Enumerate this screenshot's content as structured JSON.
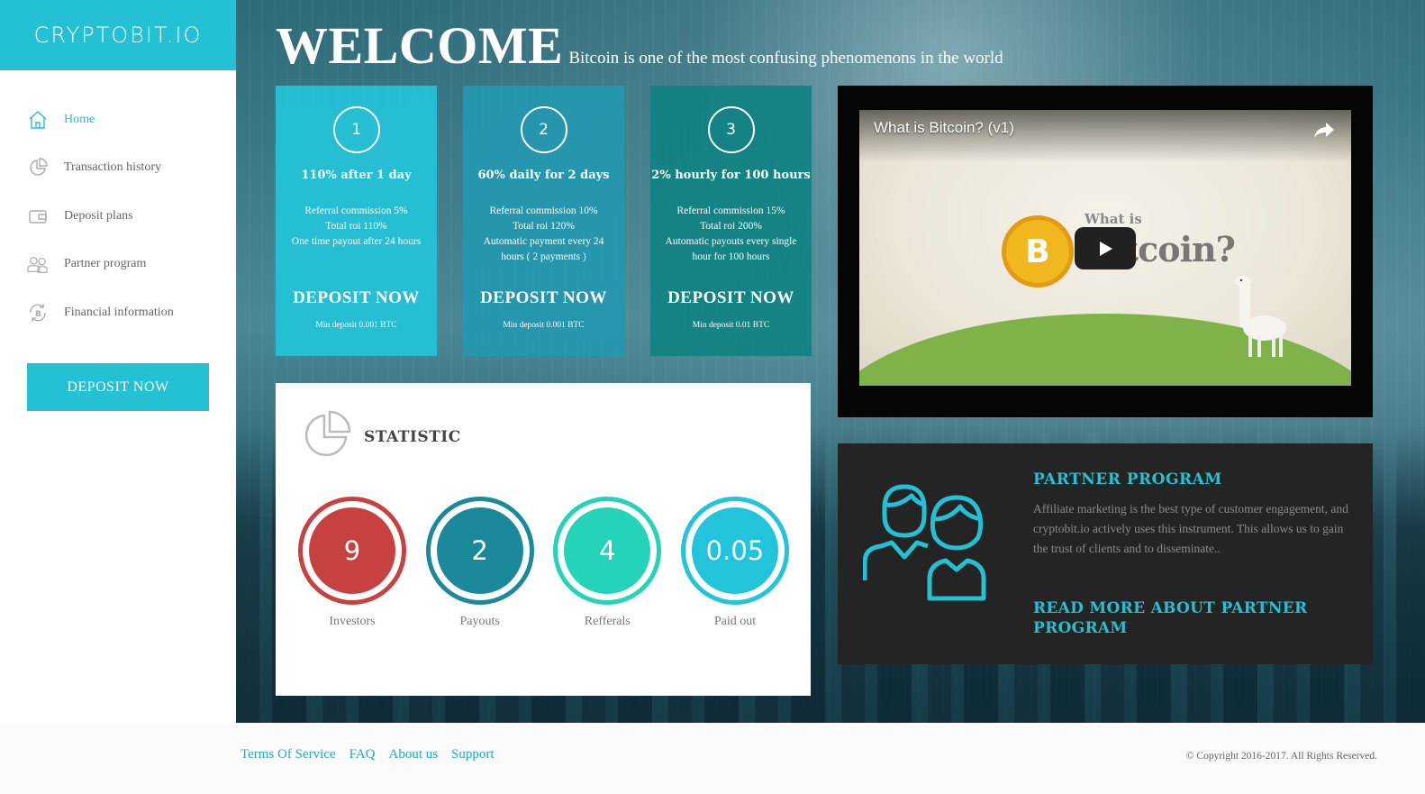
{
  "brand": {
    "logo": "CRYPTOBIT.IO"
  },
  "sidebar": {
    "items": [
      {
        "label": "Home",
        "icon": "home-icon",
        "active": true
      },
      {
        "label": "Transaction history",
        "icon": "pie-chart-icon"
      },
      {
        "label": "Deposit plans",
        "icon": "wallet-icon"
      },
      {
        "label": "Partner program",
        "icon": "users-icon"
      },
      {
        "label": "Financial information",
        "icon": "bitcoin-cycle-icon"
      }
    ],
    "cta": "DEPOSIT NOW"
  },
  "hero": {
    "title": "WELCOME",
    "subtitle": "Bitcoin is one of the most confusing phenomenons in the world"
  },
  "plans": [
    {
      "number": "1",
      "title": "110% after 1 day",
      "lines": [
        "Referral commission  5%",
        "Total roi 110%",
        "One time payout after 24 hours"
      ],
      "cta": "DEPOSIT NOW",
      "min": "Min deposit 0.001 BTC"
    },
    {
      "number": "2",
      "title": "60% daily for 2 days",
      "lines": [
        "Referral commission 10%",
        "Total roi 120%",
        "Automatic payment every 24",
        "hours ( 2 payments )"
      ],
      "cta": "DEPOSIT NOW",
      "min": "Min deposit 0.001 BTC"
    },
    {
      "number": "3",
      "title": "2% hourly for 100 hours",
      "lines": [
        "Referral commission 15%",
        "Total roi 200%",
        "Automatic payouts every single",
        "hour for 100 hours"
      ],
      "cta": "DEPOSIT NOW",
      "min": "Min deposit 0.01 BTC"
    }
  ],
  "statistic": {
    "title": "STATISTIC",
    "items": [
      {
        "value": "9",
        "label": "Investors",
        "color": "#c64140"
      },
      {
        "value": "2",
        "label": "Payouts",
        "color": "#1a8a9a"
      },
      {
        "value": "4",
        "label": "Refferals",
        "color": "#25d4b8"
      },
      {
        "value": "0.05",
        "label": "Paid out",
        "color": "#22c4dc"
      }
    ]
  },
  "video": {
    "title": "What is Bitcoin? (v1)",
    "overlay_small": "What is",
    "overlay_big": "Bitcoin?"
  },
  "partner": {
    "title": "PARTNER PROGRAM",
    "text": "Affiliate marketing is the best type of customer engagement, and cryptobit.io actively uses this instrument. This allows us to gain the trust of clients and to disseminate..",
    "more": "READ MORE ABOUT PARTNER PROGRAM"
  },
  "footer": {
    "links": [
      "Terms Of Service",
      "FAQ",
      "About us",
      "Support"
    ],
    "copyright": "© Copyright 2016-2017. All Rights Reserved."
  },
  "colors": {
    "accent": "#24c1d5",
    "dark_panel": "#242424"
  }
}
